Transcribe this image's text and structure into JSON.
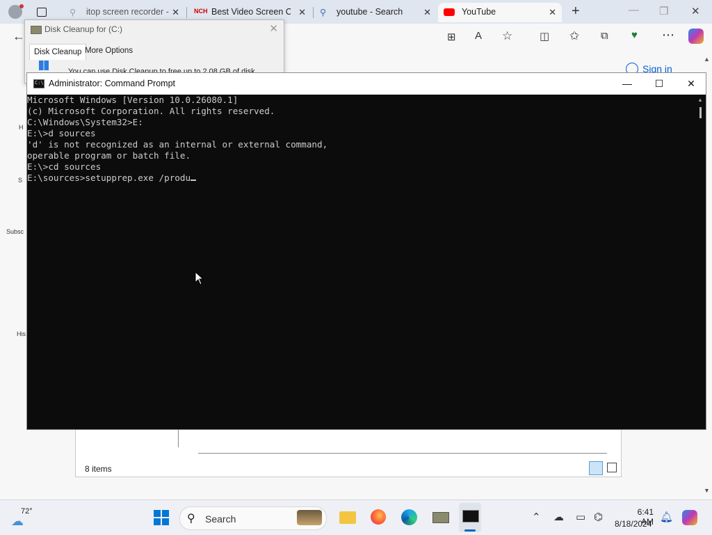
{
  "browser": {
    "tabs": [
      {
        "label": "itop screen recorder -",
        "icon": "search-icon"
      },
      {
        "label": "Best Video Screen Ca",
        "icon": "nch-logo-icon",
        "icon_text": "NCH"
      },
      {
        "label": "youtube - Search",
        "icon": "search-icon"
      },
      {
        "label": "YouTube",
        "icon": "youtube-icon"
      }
    ],
    "sign_in": "Sign in",
    "rail_fragments": [
      "H",
      "S",
      "Subsc",
      "His"
    ]
  },
  "disk_cleanup": {
    "title": "Disk Cleanup for  (C:)",
    "tabs": [
      "Disk Cleanup",
      "More Options"
    ],
    "text": "You can use Disk Cleanup to free up to 2.08 GB of disk"
  },
  "explorer": {
    "item_count": "8 items"
  },
  "cmd": {
    "title": "Administrator: Command Prompt",
    "lines": [
      "Microsoft Windows [Version 10.0.26080.1]",
      "(c) Microsoft Corporation. All rights reserved.",
      "",
      "C:\\Windows\\System32>E:",
      "",
      "E:\\>d sources",
      "'d' is not recognized as an internal or external command,",
      "operable program or batch file.",
      "",
      "E:\\>cd sources",
      "",
      "E:\\sources>setupprep.exe /produ"
    ]
  },
  "taskbar": {
    "weather": "72°",
    "search_label": "Search",
    "time": "6:41 AM",
    "date": "8/18/2024"
  },
  "colors": {
    "console_bg": "#0c0c0c",
    "console_fg": "#cccccc",
    "taskbar_bg": "#eef0f5",
    "accent": "#0067c0"
  }
}
